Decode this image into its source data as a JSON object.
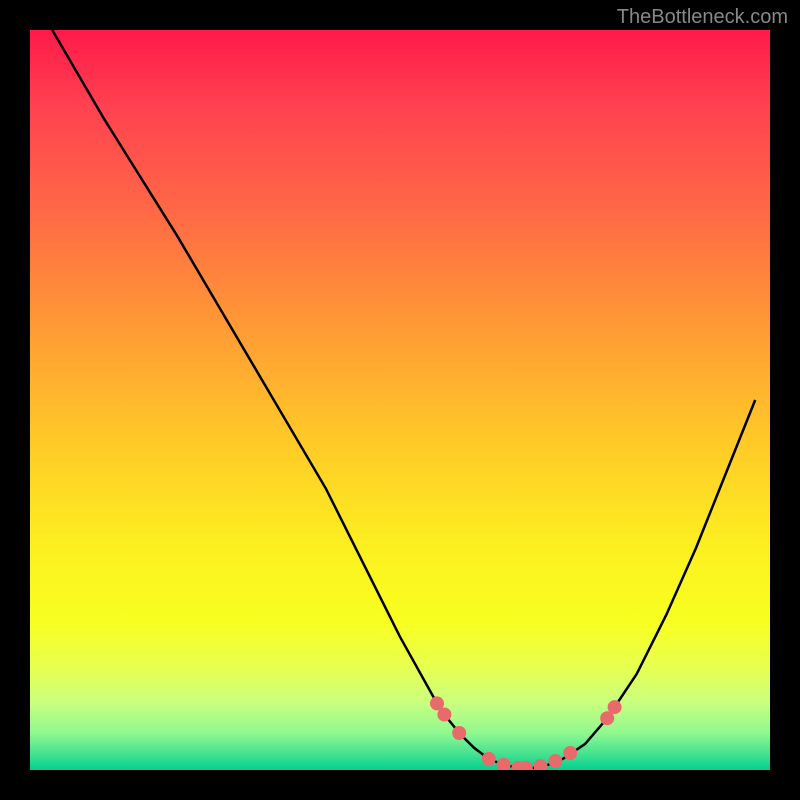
{
  "attribution": "TheBottleneck.com",
  "chart_data": {
    "type": "line",
    "title": "",
    "xlabel": "",
    "ylabel": "",
    "xlim": [
      0,
      100
    ],
    "ylim": [
      0,
      100
    ],
    "series": [
      {
        "name": "curve",
        "x": [
          3,
          10,
          20,
          30,
          40,
          45,
          50,
          55,
          56,
          58,
          60,
          62,
          64,
          66,
          68,
          70,
          72,
          75,
          78,
          82,
          86,
          90,
          94,
          98
        ],
        "y": [
          100,
          88,
          72,
          55,
          38,
          28,
          18,
          9,
          7.5,
          5,
          3,
          1.5,
          0.7,
          0.3,
          0.3,
          0.7,
          1.5,
          3.5,
          7,
          13,
          21,
          30,
          40,
          50
        ]
      }
    ],
    "markers": [
      {
        "x": 55,
        "y": 9
      },
      {
        "x": 56,
        "y": 7.5
      },
      {
        "x": 58,
        "y": 5
      },
      {
        "x": 62,
        "y": 1.5
      },
      {
        "x": 64,
        "y": 0.7
      },
      {
        "x": 66,
        "y": 0.3
      },
      {
        "x": 67,
        "y": 0.3
      },
      {
        "x": 69,
        "y": 0.5
      },
      {
        "x": 71,
        "y": 1.2
      },
      {
        "x": 73,
        "y": 2.3
      },
      {
        "x": 78,
        "y": 7
      },
      {
        "x": 79,
        "y": 8.5
      }
    ],
    "colors": {
      "line": "#000000",
      "marker": "#e86a6a",
      "gradient_top": "#ff1a4a",
      "gradient_mid": "#fcf020",
      "gradient_bottom": "#00d090"
    }
  }
}
